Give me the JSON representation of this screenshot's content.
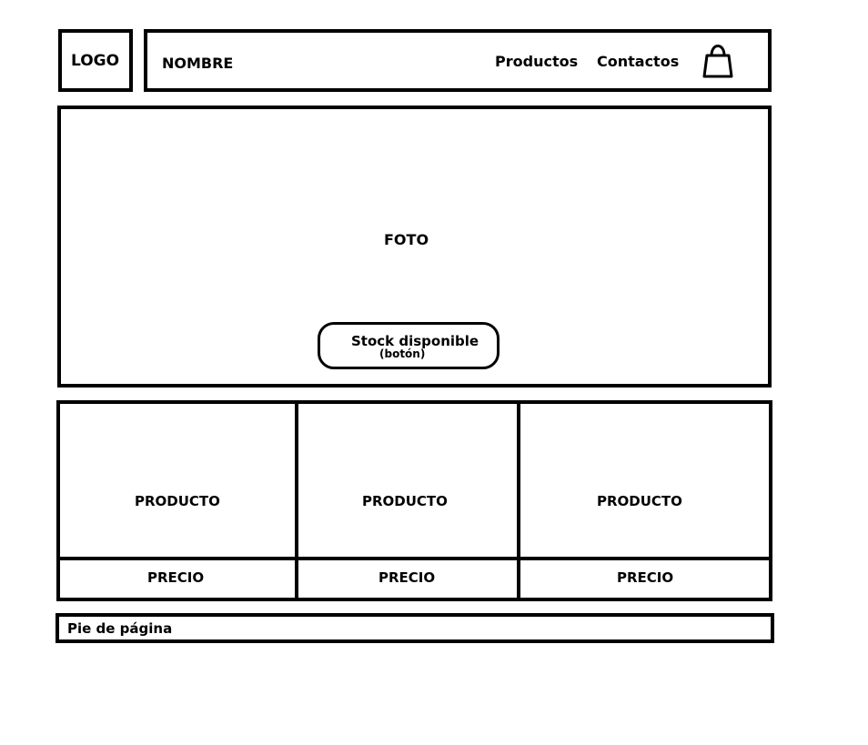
{
  "header": {
    "logo_text": "LOGO",
    "site_name": "NOMBRE",
    "nav": {
      "productos": "Productos",
      "contactos": "Contactos"
    },
    "cart_icon": "shopping-bag-icon"
  },
  "hero": {
    "photo_label": "FOTO",
    "stock_button": {
      "label": "Stock disponible",
      "sub_label": "(botón)"
    }
  },
  "products": [
    {
      "name": "PRODUCTO",
      "price": "PRECIO"
    },
    {
      "name": "PRODUCTO",
      "price": "PRECIO"
    },
    {
      "name": "PRODUCTO",
      "price": "PRECIO"
    }
  ],
  "footer": {
    "text": "Pie de página"
  },
  "colors": {
    "stroke": "#000000",
    "background": "#ffffff"
  }
}
